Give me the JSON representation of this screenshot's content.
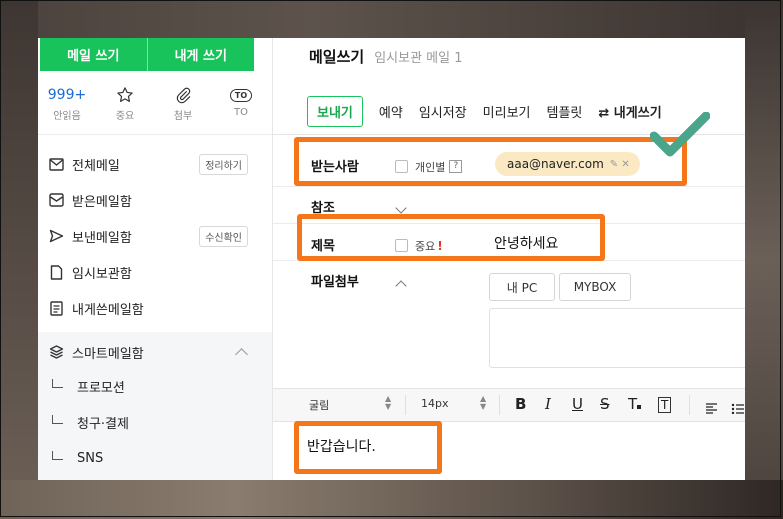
{
  "sidebar": {
    "write_mail": "메일 쓰기",
    "write_to_me": "내게 쓰기",
    "quick": [
      {
        "value": "999+",
        "label": "안읽음"
      },
      {
        "label": "중요"
      },
      {
        "label": "첨부"
      },
      {
        "value": "TO",
        "label": "TO"
      }
    ],
    "nav": [
      {
        "label": "전체메일",
        "badge": "정리하기"
      },
      {
        "label": "받은메일함"
      },
      {
        "label": "보낸메일함",
        "badge": "수신확인"
      },
      {
        "label": "임시보관함"
      },
      {
        "label": "내게쓴메일함"
      }
    ],
    "smart": {
      "label": "스마트메일함",
      "items": [
        "프로모션",
        "청구·결제",
        "SNS"
      ]
    }
  },
  "compose": {
    "title": "메일쓰기",
    "subtitle": "임시보관 메일 1",
    "toolbar": {
      "send": "보내기",
      "reserve": "예약",
      "save_draft": "임시저장",
      "preview": "미리보기",
      "template": "템플릿",
      "to_me": "⇄ 내게쓰기"
    },
    "to": {
      "label": "받는사람",
      "individual": "개인별",
      "help": "?",
      "recipient": "aaa@naver.com"
    },
    "cc": {
      "label": "참조"
    },
    "subject": {
      "label": "제목",
      "important": "중요",
      "mark": "!",
      "value": "안녕하세요"
    },
    "attach": {
      "label": "파일첨부",
      "my_pc": "내 PC",
      "mybox": "MYBOX"
    },
    "format": {
      "font": "굴림",
      "size": "14px"
    },
    "body": "반갑습니다."
  },
  "colors": {
    "brand_green": "#19c35c",
    "highlight": "#f5761a",
    "chip_bg": "#fbe9c3",
    "link_blue": "#1a6bd6"
  }
}
